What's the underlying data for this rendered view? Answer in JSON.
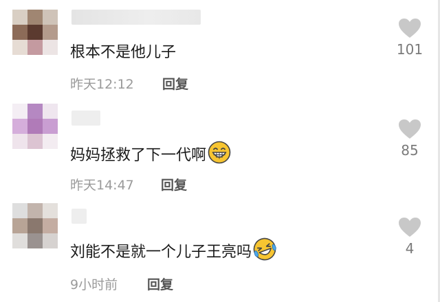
{
  "comments": [
    {
      "text": "根本不是他儿子",
      "time": "昨天12:12",
      "reply_label": "回复",
      "likes": "101",
      "emoji": ""
    },
    {
      "text": "妈妈拯救了下一代啊",
      "time": "昨天14:47",
      "reply_label": "回复",
      "likes": "85",
      "emoji": "grinning-face-icon"
    },
    {
      "text": "刘能不是就一个儿子王亮吗",
      "time": "9小时前",
      "reply_label": "回复",
      "likes": "4",
      "emoji": "laughing-tears-face-icon"
    }
  ],
  "colors": {
    "text": "#1a1a1a",
    "meta": "#9a9a9a",
    "reply": "#555555",
    "heart": "#c8c8c8",
    "emoji_yellow": "#f7c531"
  }
}
